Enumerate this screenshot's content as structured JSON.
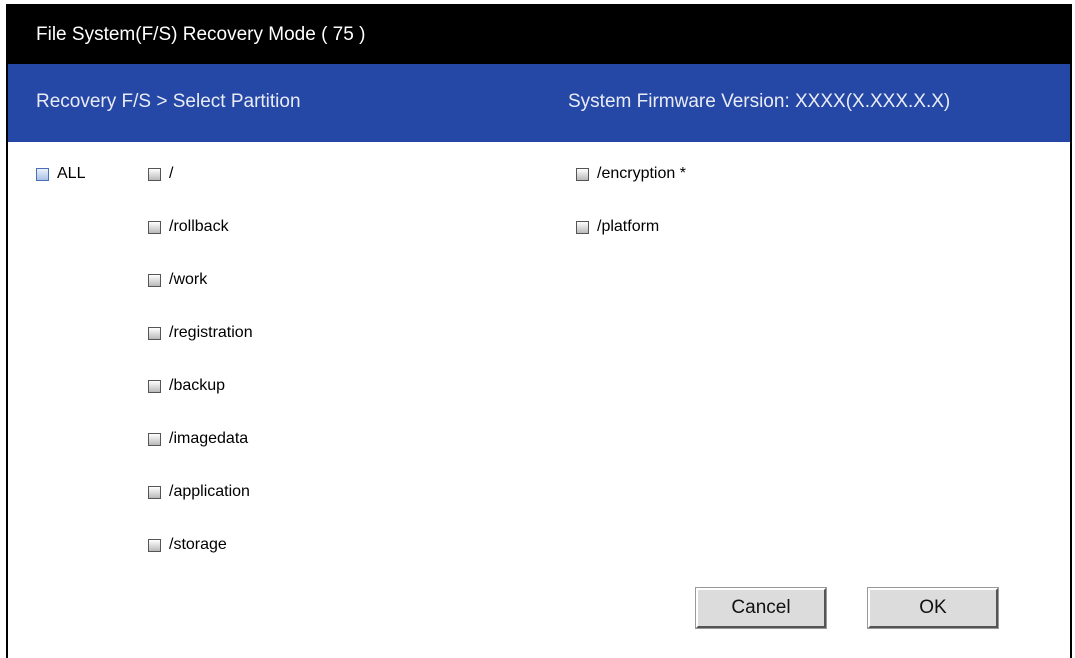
{
  "window": {
    "title": "File System(F/S) Recovery Mode ( 75 )"
  },
  "header": {
    "breadcrumb": "Recovery F/S > Select Partition",
    "firmware_version": "System Firmware Version: XXXX(X.XXX.X.X)"
  },
  "options": {
    "all_label": "ALL",
    "col1": [
      {
        "label": "/"
      },
      {
        "label": "/rollback"
      },
      {
        "label": "/work"
      },
      {
        "label": "/registration"
      },
      {
        "label": "/backup"
      },
      {
        "label": "/imagedata"
      },
      {
        "label": "/application"
      },
      {
        "label": "/storage"
      }
    ],
    "col2": [
      {
        "label": "/encryption *"
      },
      {
        "label": "/platform"
      }
    ]
  },
  "buttons": {
    "cancel": "Cancel",
    "ok": "OK"
  },
  "colors": {
    "titlebar_bg": "#000000",
    "header_bg": "#2547a6"
  }
}
